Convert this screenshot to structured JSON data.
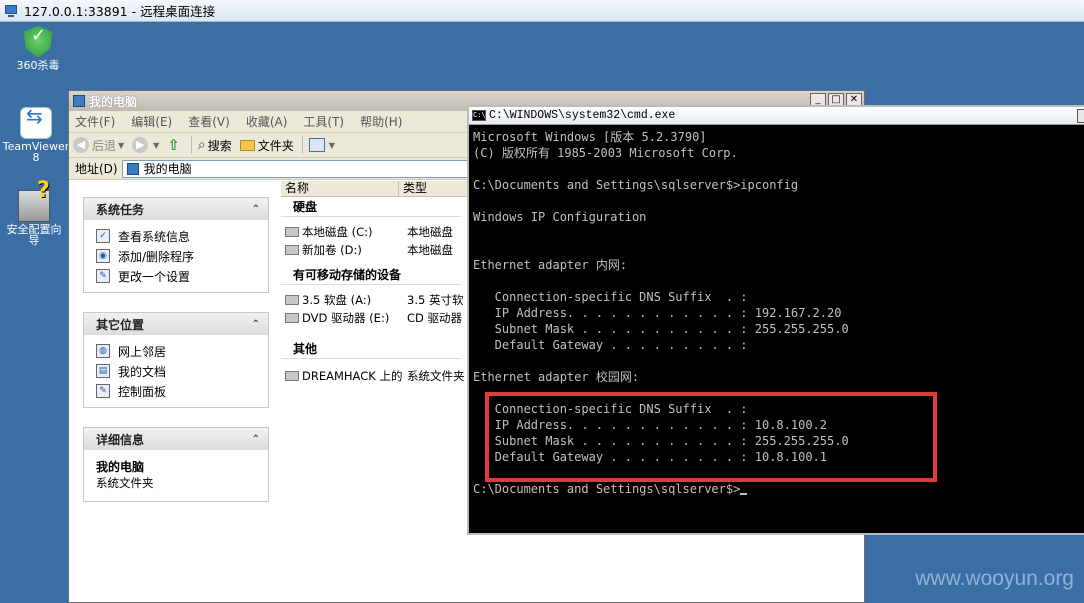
{
  "rdp": {
    "title": "127.0.0.1:33891 - 远程桌面连接"
  },
  "desktop_icons": [
    {
      "label1": "360杀毒",
      "label2": ""
    },
    {
      "label1": "TeamViewer",
      "label2": "8"
    },
    {
      "label1": "安全配置向",
      "label2": "导"
    }
  ],
  "explorer": {
    "title": "我的电脑",
    "menu": [
      "文件(F)",
      "编辑(E)",
      "查看(V)",
      "收藏(A)",
      "工具(T)",
      "帮助(H)"
    ],
    "toolbar": {
      "back": "后退",
      "search": "搜索",
      "folders": "文件夹"
    },
    "address": {
      "label": "地址(D)",
      "value": "我的电脑"
    },
    "panels": {
      "system_tasks": {
        "title": "系统任务",
        "items": [
          "查看系统信息",
          "添加/删除程序",
          "更改一个设置"
        ]
      },
      "other_places": {
        "title": "其它位置",
        "items": [
          "网上邻居",
          "我的文档",
          "控制面板"
        ]
      },
      "details": {
        "title": "详细信息",
        "name": "我的电脑",
        "type": "系统文件夹"
      }
    },
    "columns": [
      "名称",
      "类型"
    ],
    "groups": [
      {
        "title": "硬盘",
        "rows": [
          {
            "name": "本地磁盘 (C:)",
            "type": "本地磁盘"
          },
          {
            "name": "新加卷 (D:)",
            "type": "本地磁盘"
          }
        ]
      },
      {
        "title": "有可移动存储的设备",
        "rows": [
          {
            "name": "3.5 软盘 (A:)",
            "type": "3.5 英寸软"
          },
          {
            "name": "DVD 驱动器 (E:)",
            "type": "CD 驱动器"
          }
        ]
      },
      {
        "title": "其他",
        "rows": [
          {
            "name": "DREAMHACK 上的 D",
            "type": "系统文件夹"
          }
        ]
      }
    ]
  },
  "cmd": {
    "title": "C:\\WINDOWS\\system32\\cmd.exe",
    "lines": [
      "Microsoft Windows [版本 5.2.3790]",
      "(C) 版权所有 1985-2003 Microsoft Corp.",
      "",
      "C:\\Documents and Settings\\sqlserver$>ipconfig",
      "",
      "Windows IP Configuration",
      "",
      "",
      "Ethernet adapter 内网:",
      "",
      "   Connection-specific DNS Suffix  . :",
      "   IP Address. . . . . . . . . . . . : 192.167.2.20",
      "   Subnet Mask . . . . . . . . . . . : 255.255.255.0",
      "   Default Gateway . . . . . . . . . :",
      "",
      "Ethernet adapter 校园网:",
      "",
      "   Connection-specific DNS Suffix  . :",
      "   IP Address. . . . . . . . . . . . : 10.8.100.2",
      "   Subnet Mask . . . . . . . . . . . : 255.255.255.0",
      "   Default Gateway . . . . . . . . . : 10.8.100.1",
      "",
      "C:\\Documents and Settings\\sqlserver$>"
    ]
  },
  "watermark": "www.wooyun.org",
  "colors": {
    "desktop": "#3a6ea5",
    "highlight": "#e03a3a",
    "console_text": "#c0c0c0"
  }
}
